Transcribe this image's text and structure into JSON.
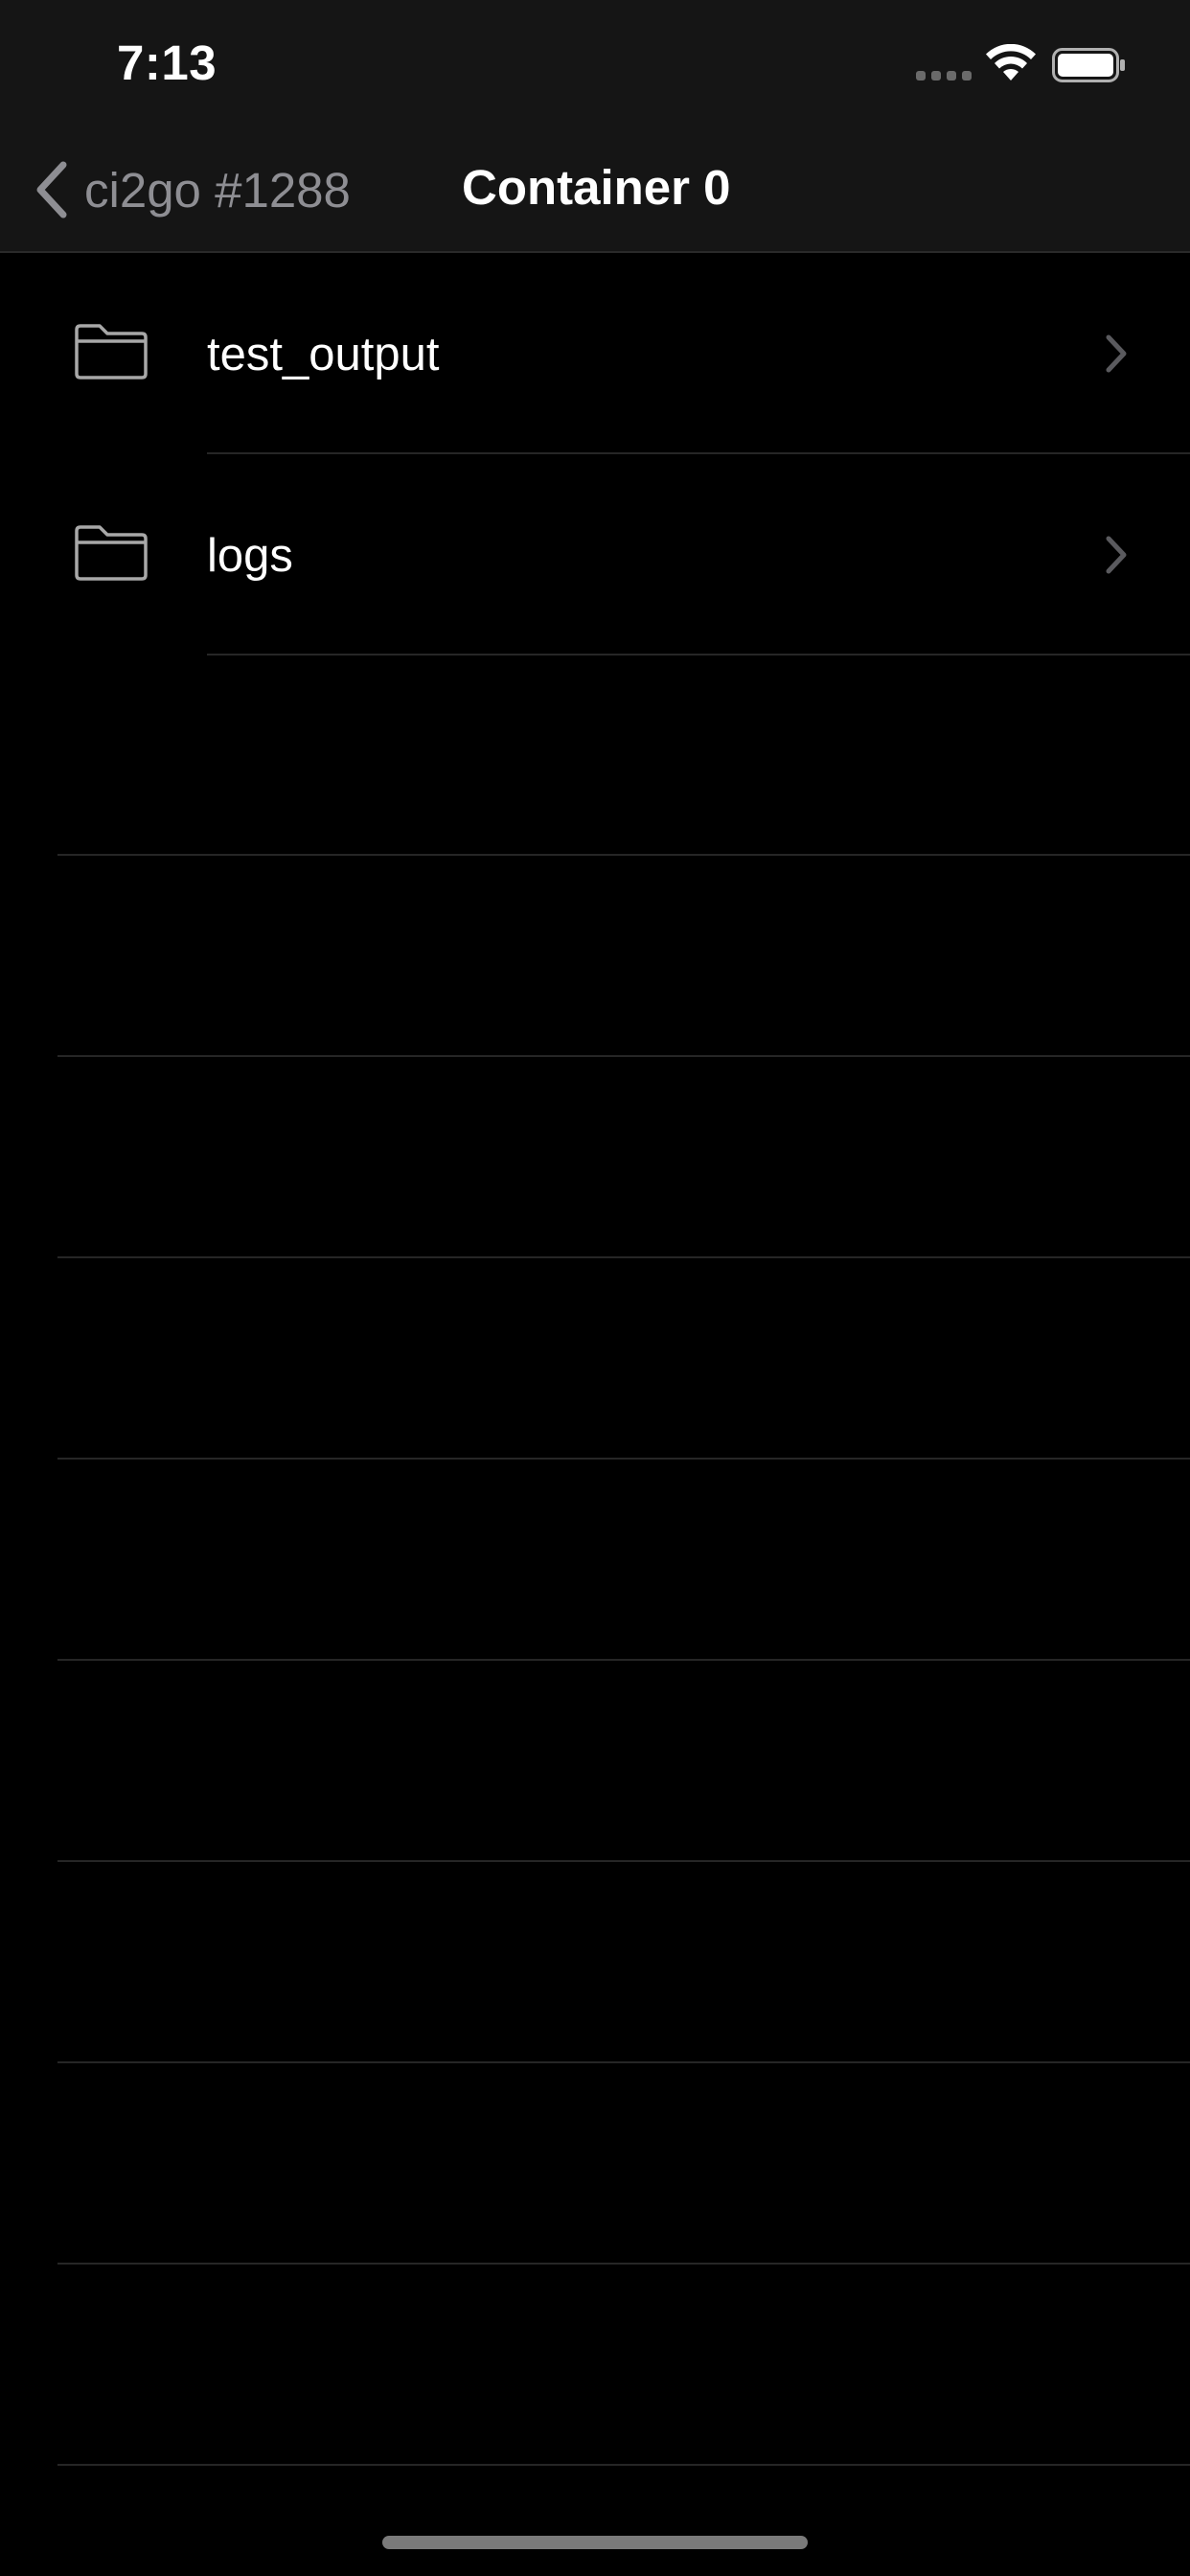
{
  "status_bar": {
    "time": "7:13"
  },
  "nav": {
    "back_label": "ci2go #1288",
    "title": "Container 0"
  },
  "list": {
    "items": [
      {
        "label": "test_output",
        "icon": "folder-icon"
      },
      {
        "label": "logs",
        "icon": "folder-icon"
      }
    ]
  },
  "colors": {
    "background": "#000000",
    "nav_background": "#151515",
    "secondary_text": "#8e8e93",
    "separator": "#262626"
  }
}
